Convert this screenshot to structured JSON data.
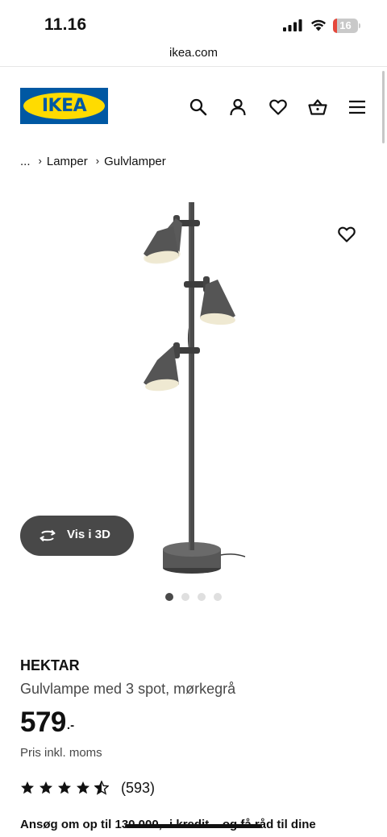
{
  "status_bar": {
    "time": "11.16",
    "battery_level": "16",
    "battery_fraction": 0.16,
    "battery_color": "#e5483c"
  },
  "browser": {
    "url": "ikea.com"
  },
  "header": {
    "logo_text": "IKEA",
    "logo_colors": {
      "blue": "#0058a3",
      "yellow": "#ffdb00"
    },
    "icons": [
      "search-icon",
      "account-icon",
      "heart-icon",
      "basket-icon",
      "menu-icon"
    ]
  },
  "breadcrumb": {
    "items": [
      "...",
      "Lamper",
      "Gulvlamper"
    ],
    "separator": "›"
  },
  "gallery": {
    "view_3d_label": "Vis i 3D",
    "slide_count": 4,
    "active_slide": 1
  },
  "product": {
    "name": "HEKTAR",
    "description": "Gulvlampe med 3 spot, mørkegrå",
    "price": "579",
    "price_suffix": ".-",
    "vat_note": "Pris inkl. moms",
    "rating": 4.5,
    "rating_max": 5,
    "review_count": "(593)"
  },
  "credit_banner": {
    "text": "Ansøg om op til 130.000,- i kredit – og få råd til dine"
  }
}
